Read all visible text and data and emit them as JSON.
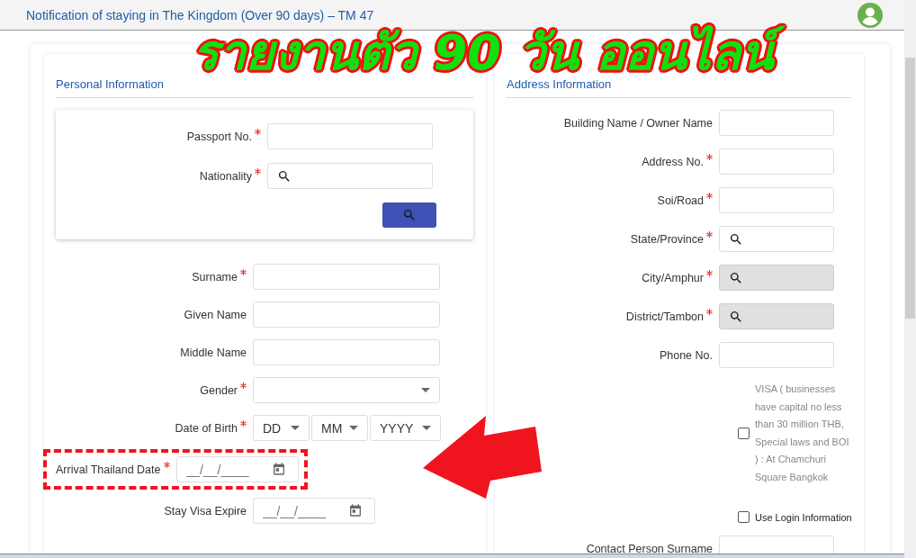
{
  "header": {
    "title": "Notification of staying in The Kingdom (Over 90 days) – TM 47"
  },
  "annotation": {
    "caption": "รายงานตัว 90 วัน ออนไลน์"
  },
  "personal": {
    "heading": "Personal Information",
    "lookup_fields": [
      {
        "label": "Passport No.",
        "required": true,
        "kind": "text"
      },
      {
        "label": "Nationality",
        "required": true,
        "kind": "search"
      }
    ],
    "fields": [
      {
        "label": "Surname",
        "required": true,
        "kind": "text",
        "highlighted": false
      },
      {
        "label": "Given Name",
        "required": false,
        "kind": "text",
        "highlighted": false
      },
      {
        "label": "Middle Name",
        "required": false,
        "kind": "text",
        "highlighted": false
      },
      {
        "label": "Gender",
        "required": true,
        "kind": "select",
        "highlighted": false
      },
      {
        "label": "Date of Birth",
        "required": true,
        "kind": "date_parts",
        "parts": [
          "DD",
          "MM",
          "YYYY"
        ],
        "highlighted": false
      },
      {
        "label": "Arrival Thailand Date",
        "required": true,
        "kind": "date",
        "placeholder": "__/__/____",
        "highlighted": true
      },
      {
        "label": "Stay Visa Expire",
        "required": false,
        "kind": "date",
        "placeholder": "__/__/____",
        "highlighted": false
      }
    ]
  },
  "address": {
    "heading": "Address Information",
    "fields": [
      {
        "label": "Building Name / Owner Name",
        "required": false,
        "kind": "text",
        "disabled": false
      },
      {
        "label": "Address No.",
        "required": true,
        "kind": "text",
        "disabled": false
      },
      {
        "label": "Soi/Road",
        "required": true,
        "kind": "text",
        "disabled": false
      },
      {
        "label": "State/Province",
        "required": true,
        "kind": "search",
        "disabled": false
      },
      {
        "label": "City/Amphur",
        "required": true,
        "kind": "search",
        "disabled": true
      },
      {
        "label": "District/Tambon",
        "required": true,
        "kind": "search",
        "disabled": true
      },
      {
        "label": "Phone No.",
        "required": false,
        "kind": "text",
        "disabled": false
      }
    ],
    "options": [
      {
        "label": "VISA ( businesses have capital no less than 30 million THB, Special laws and BOI ) : At Chamchuri Square Bangkok",
        "checked": false,
        "kind": "wrapped"
      },
      {
        "label": "Use Login Information",
        "checked": false,
        "kind": "inline"
      }
    ],
    "more_fields": [
      {
        "label": "Contact Person Surname",
        "required": false,
        "kind": "text",
        "disabled": false
      }
    ]
  }
}
